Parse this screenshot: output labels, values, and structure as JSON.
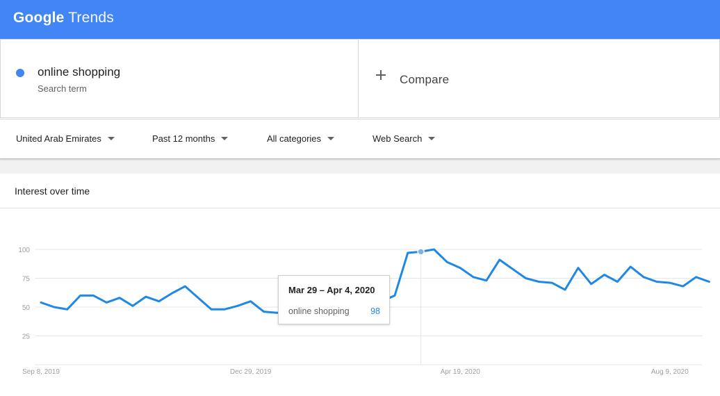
{
  "app": {
    "logo_primary": "Google",
    "logo_secondary": "Trends"
  },
  "search_term": {
    "name": "online shopping",
    "label": "Search term",
    "color": "#4285f4"
  },
  "compare": {
    "label": "Compare",
    "icon": "plus-icon"
  },
  "filters": [
    {
      "label": "United Arab Emirates",
      "icon": "caret-down-icon"
    },
    {
      "label": "Past 12 months",
      "icon": "caret-down-icon"
    },
    {
      "label": "All categories",
      "icon": "caret-down-icon"
    },
    {
      "label": "Web Search",
      "icon": "caret-down-icon"
    }
  ],
  "panel": {
    "title": "Interest over time"
  },
  "tooltip": {
    "date": "Mar 29 – Apr 4, 2020",
    "term": "online shopping",
    "value": "98"
  },
  "chart_data": {
    "type": "line",
    "ylim": [
      0,
      100
    ],
    "yticks": [
      25,
      50,
      75,
      100
    ],
    "ytick_labels": [
      "25",
      "50",
      "75",
      "100"
    ],
    "xtick_labels": [
      "Sep 8, 2019",
      "Dec 29, 2019",
      "Apr 19, 2020",
      "Aug 9, 2020"
    ],
    "xtick_week_index": [
      0,
      16,
      32,
      48
    ],
    "highlight_index": 29,
    "grid": true,
    "series": [
      {
        "color": "#1e88e5",
        "values": [
          54,
          50,
          48,
          60,
          60,
          54,
          58,
          51,
          59,
          55,
          62,
          68,
          58,
          48,
          48,
          51,
          55,
          46,
          45,
          46,
          50,
          52,
          54,
          53,
          48,
          52,
          55,
          60,
          97,
          98,
          100,
          89,
          84,
          76,
          73,
          91,
          83,
          75,
          72,
          71,
          65,
          84,
          70,
          78,
          72,
          85,
          76,
          72,
          71,
          68,
          76,
          72
        ]
      }
    ]
  }
}
